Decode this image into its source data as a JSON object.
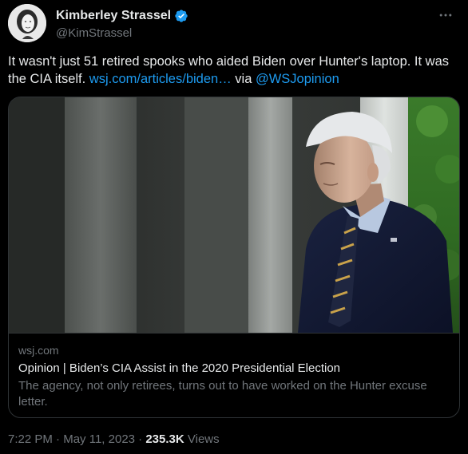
{
  "author": {
    "display_name": "Kimberley Strassel",
    "handle": "@KimStrassel",
    "verified_color": "#1d9bf0"
  },
  "tweet": {
    "text_before": "It wasn't just 51 retired spooks who aided Biden over Hunter's laptop. It was the CIA itself. ",
    "link_text": "wsj.com/articles/biden…",
    "text_via": " via ",
    "mention": "@WSJopinion"
  },
  "card": {
    "domain": "wsj.com",
    "title": "Opinion | Biden’s CIA Assist in the 2020 Presidential Election",
    "description": "The agency, not only retirees, turns out to have worked on the Hunter excuse letter."
  },
  "meta": {
    "time": "7:22 PM",
    "separator": " · ",
    "date": "May 11, 2023",
    "views_count": "235.3K",
    "views_label": " Views"
  },
  "colors": {
    "background": "#000000",
    "text": "#e7e9ea",
    "secondary": "#71767b",
    "link": "#1d9bf0",
    "border": "#2f3336"
  },
  "icons": {
    "verified": "verified-badge-icon",
    "more": "more-horizontal-icon"
  }
}
